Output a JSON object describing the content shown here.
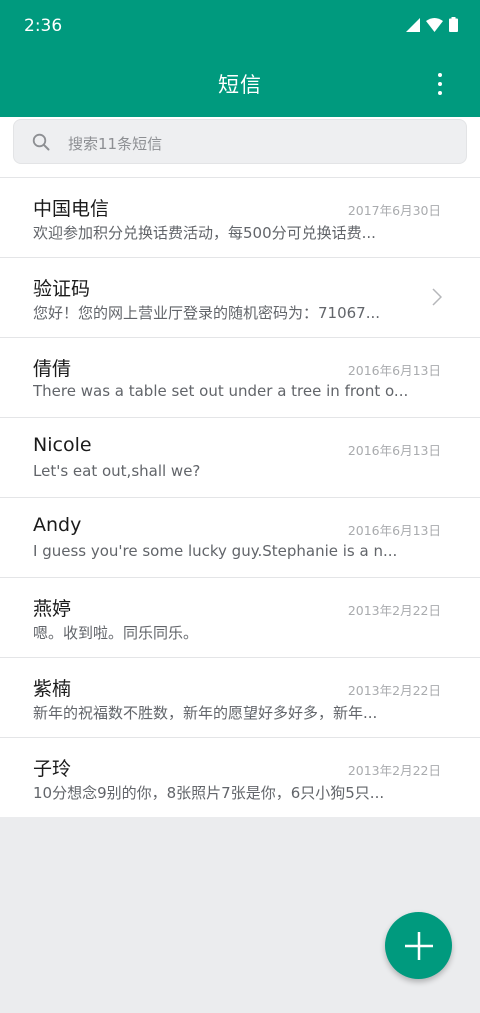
{
  "status": {
    "time": "2:36"
  },
  "header": {
    "title": "短信"
  },
  "search": {
    "placeholder": "搜索11条短信"
  },
  "messages": [
    {
      "name": "中国电信",
      "date": "2017年6月30日",
      "preview": "欢迎参加积分兑换话费活动，每500分可兑换话费..."
    },
    {
      "name": "验证码",
      "date": "",
      "preview": "您好！您的网上营业厅登录的随机密码为：71067..."
    },
    {
      "name": "倩倩",
      "date": "2016年6月13日",
      "preview": "There was a table set out under a tree in front o..."
    },
    {
      "name": "Nicole",
      "date": "2016年6月13日",
      "preview": "Let's eat out,shall we?"
    },
    {
      "name": "Andy",
      "date": "2016年6月13日",
      "preview": "I guess you're some lucky guy.Stephanie is a n..."
    },
    {
      "name": "燕婷",
      "date": "2013年2月22日",
      "preview": "嗯。收到啦。同乐同乐。"
    },
    {
      "name": "紫楠",
      "date": "2013年2月22日",
      "preview": "新年的祝福数不胜数，新年的愿望好多好多，新年..."
    },
    {
      "name": "子玲",
      "date": "2013年2月22日",
      "preview": "10分想念9别的你，8张照片7张是你，6只小狗5只..."
    }
  ],
  "colors": {
    "accent": "#009a7e",
    "background": "#ebecee"
  },
  "icons": {
    "search": "search-icon",
    "more": "more-vert-icon",
    "fab": "plus-icon",
    "chevron": "chevron-right-icon"
  }
}
